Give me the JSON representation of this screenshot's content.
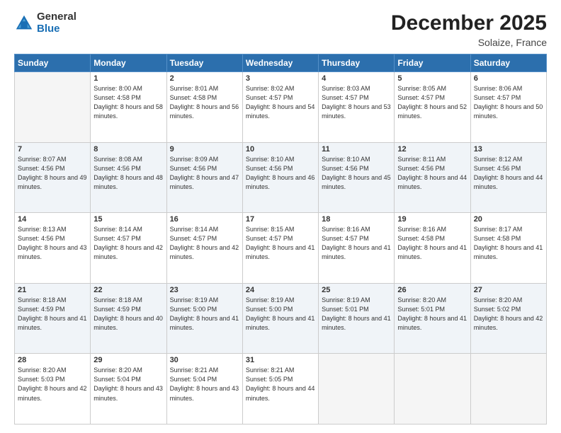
{
  "logo": {
    "general": "General",
    "blue": "Blue"
  },
  "title": "December 2025",
  "location": "Solaize, France",
  "days_header": [
    "Sunday",
    "Monday",
    "Tuesday",
    "Wednesday",
    "Thursday",
    "Friday",
    "Saturday"
  ],
  "weeks": [
    [
      {
        "day": "",
        "sunrise": "",
        "sunset": "",
        "daylight": ""
      },
      {
        "day": "1",
        "sunrise": "Sunrise: 8:00 AM",
        "sunset": "Sunset: 4:58 PM",
        "daylight": "Daylight: 8 hours and 58 minutes."
      },
      {
        "day": "2",
        "sunrise": "Sunrise: 8:01 AM",
        "sunset": "Sunset: 4:58 PM",
        "daylight": "Daylight: 8 hours and 56 minutes."
      },
      {
        "day": "3",
        "sunrise": "Sunrise: 8:02 AM",
        "sunset": "Sunset: 4:57 PM",
        "daylight": "Daylight: 8 hours and 54 minutes."
      },
      {
        "day": "4",
        "sunrise": "Sunrise: 8:03 AM",
        "sunset": "Sunset: 4:57 PM",
        "daylight": "Daylight: 8 hours and 53 minutes."
      },
      {
        "day": "5",
        "sunrise": "Sunrise: 8:05 AM",
        "sunset": "Sunset: 4:57 PM",
        "daylight": "Daylight: 8 hours and 52 minutes."
      },
      {
        "day": "6",
        "sunrise": "Sunrise: 8:06 AM",
        "sunset": "Sunset: 4:57 PM",
        "daylight": "Daylight: 8 hours and 50 minutes."
      }
    ],
    [
      {
        "day": "7",
        "sunrise": "Sunrise: 8:07 AM",
        "sunset": "Sunset: 4:56 PM",
        "daylight": "Daylight: 8 hours and 49 minutes."
      },
      {
        "day": "8",
        "sunrise": "Sunrise: 8:08 AM",
        "sunset": "Sunset: 4:56 PM",
        "daylight": "Daylight: 8 hours and 48 minutes."
      },
      {
        "day": "9",
        "sunrise": "Sunrise: 8:09 AM",
        "sunset": "Sunset: 4:56 PM",
        "daylight": "Daylight: 8 hours and 47 minutes."
      },
      {
        "day": "10",
        "sunrise": "Sunrise: 8:10 AM",
        "sunset": "Sunset: 4:56 PM",
        "daylight": "Daylight: 8 hours and 46 minutes."
      },
      {
        "day": "11",
        "sunrise": "Sunrise: 8:10 AM",
        "sunset": "Sunset: 4:56 PM",
        "daylight": "Daylight: 8 hours and 45 minutes."
      },
      {
        "day": "12",
        "sunrise": "Sunrise: 8:11 AM",
        "sunset": "Sunset: 4:56 PM",
        "daylight": "Daylight: 8 hours and 44 minutes."
      },
      {
        "day": "13",
        "sunrise": "Sunrise: 8:12 AM",
        "sunset": "Sunset: 4:56 PM",
        "daylight": "Daylight: 8 hours and 44 minutes."
      }
    ],
    [
      {
        "day": "14",
        "sunrise": "Sunrise: 8:13 AM",
        "sunset": "Sunset: 4:56 PM",
        "daylight": "Daylight: 8 hours and 43 minutes."
      },
      {
        "day": "15",
        "sunrise": "Sunrise: 8:14 AM",
        "sunset": "Sunset: 4:57 PM",
        "daylight": "Daylight: 8 hours and 42 minutes."
      },
      {
        "day": "16",
        "sunrise": "Sunrise: 8:14 AM",
        "sunset": "Sunset: 4:57 PM",
        "daylight": "Daylight: 8 hours and 42 minutes."
      },
      {
        "day": "17",
        "sunrise": "Sunrise: 8:15 AM",
        "sunset": "Sunset: 4:57 PM",
        "daylight": "Daylight: 8 hours and 41 minutes."
      },
      {
        "day": "18",
        "sunrise": "Sunrise: 8:16 AM",
        "sunset": "Sunset: 4:57 PM",
        "daylight": "Daylight: 8 hours and 41 minutes."
      },
      {
        "day": "19",
        "sunrise": "Sunrise: 8:16 AM",
        "sunset": "Sunset: 4:58 PM",
        "daylight": "Daylight: 8 hours and 41 minutes."
      },
      {
        "day": "20",
        "sunrise": "Sunrise: 8:17 AM",
        "sunset": "Sunset: 4:58 PM",
        "daylight": "Daylight: 8 hours and 41 minutes."
      }
    ],
    [
      {
        "day": "21",
        "sunrise": "Sunrise: 8:18 AM",
        "sunset": "Sunset: 4:59 PM",
        "daylight": "Daylight: 8 hours and 41 minutes."
      },
      {
        "day": "22",
        "sunrise": "Sunrise: 8:18 AM",
        "sunset": "Sunset: 4:59 PM",
        "daylight": "Daylight: 8 hours and 40 minutes."
      },
      {
        "day": "23",
        "sunrise": "Sunrise: 8:19 AM",
        "sunset": "Sunset: 5:00 PM",
        "daylight": "Daylight: 8 hours and 41 minutes."
      },
      {
        "day": "24",
        "sunrise": "Sunrise: 8:19 AM",
        "sunset": "Sunset: 5:00 PM",
        "daylight": "Daylight: 8 hours and 41 minutes."
      },
      {
        "day": "25",
        "sunrise": "Sunrise: 8:19 AM",
        "sunset": "Sunset: 5:01 PM",
        "daylight": "Daylight: 8 hours and 41 minutes."
      },
      {
        "day": "26",
        "sunrise": "Sunrise: 8:20 AM",
        "sunset": "Sunset: 5:01 PM",
        "daylight": "Daylight: 8 hours and 41 minutes."
      },
      {
        "day": "27",
        "sunrise": "Sunrise: 8:20 AM",
        "sunset": "Sunset: 5:02 PM",
        "daylight": "Daylight: 8 hours and 42 minutes."
      }
    ],
    [
      {
        "day": "28",
        "sunrise": "Sunrise: 8:20 AM",
        "sunset": "Sunset: 5:03 PM",
        "daylight": "Daylight: 8 hours and 42 minutes."
      },
      {
        "day": "29",
        "sunrise": "Sunrise: 8:20 AM",
        "sunset": "Sunset: 5:04 PM",
        "daylight": "Daylight: 8 hours and 43 minutes."
      },
      {
        "day": "30",
        "sunrise": "Sunrise: 8:21 AM",
        "sunset": "Sunset: 5:04 PM",
        "daylight": "Daylight: 8 hours and 43 minutes."
      },
      {
        "day": "31",
        "sunrise": "Sunrise: 8:21 AM",
        "sunset": "Sunset: 5:05 PM",
        "daylight": "Daylight: 8 hours and 44 minutes."
      },
      {
        "day": "",
        "sunrise": "",
        "sunset": "",
        "daylight": ""
      },
      {
        "day": "",
        "sunrise": "",
        "sunset": "",
        "daylight": ""
      },
      {
        "day": "",
        "sunrise": "",
        "sunset": "",
        "daylight": ""
      }
    ]
  ]
}
